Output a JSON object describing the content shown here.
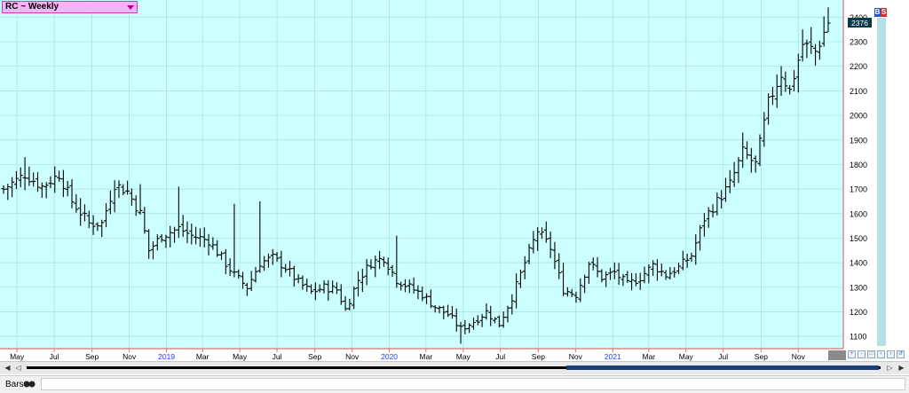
{
  "title": "RC ~ Weekly",
  "badges": {
    "b": "B",
    "s": "S"
  },
  "last_price_label": "2376",
  "status_bar": {
    "chart_style_label": "Bars"
  },
  "colors": {
    "plot_background": "#ccffff",
    "grid": "#a8dde0",
    "price_bar": "#000000",
    "axis_line": "#e07070",
    "title_box": "#f6b4f6",
    "last_price_box": "#0a3a4a",
    "year_label": "#1a3cff"
  },
  "chart_data": {
    "type": "ohlc",
    "title": "RC ~ Weekly",
    "interval": "weekly",
    "x_start": "2018-04-09",
    "x_end": "2021-12-20",
    "ylim": [
      1050,
      2470
    ],
    "y_ticks": [
      1100,
      1200,
      1300,
      1400,
      1500,
      1600,
      1700,
      1800,
      1900,
      2000,
      2100,
      2200,
      2300,
      2400
    ],
    "x_tick_labels": [
      {
        "label": "May",
        "date": "2018-05-01",
        "year": false
      },
      {
        "label": "Jul",
        "date": "2018-07-01",
        "year": false
      },
      {
        "label": "Sep",
        "date": "2018-09-01",
        "year": false
      },
      {
        "label": "Nov",
        "date": "2018-11-01",
        "year": false
      },
      {
        "label": "2019",
        "date": "2019-01-01",
        "year": true
      },
      {
        "label": "Mar",
        "date": "2019-03-01",
        "year": false
      },
      {
        "label": "May",
        "date": "2019-05-01",
        "year": false
      },
      {
        "label": "Jul",
        "date": "2019-07-01",
        "year": false
      },
      {
        "label": "Sep",
        "date": "2019-09-01",
        "year": false
      },
      {
        "label": "Nov",
        "date": "2019-11-01",
        "year": false
      },
      {
        "label": "2020",
        "date": "2020-01-01",
        "year": true
      },
      {
        "label": "Mar",
        "date": "2020-03-01",
        "year": false
      },
      {
        "label": "May",
        "date": "2020-05-01",
        "year": false
      },
      {
        "label": "Jul",
        "date": "2020-07-01",
        "year": false
      },
      {
        "label": "Sep",
        "date": "2020-09-01",
        "year": false
      },
      {
        "label": "Nov",
        "date": "2020-11-01",
        "year": false
      },
      {
        "label": "2021",
        "date": "2021-01-01",
        "year": true
      },
      {
        "label": "Mar",
        "date": "2021-03-01",
        "year": false
      },
      {
        "label": "May",
        "date": "2021-05-01",
        "year": false
      },
      {
        "label": "Jul",
        "date": "2021-07-01",
        "year": false
      },
      {
        "label": "Sep",
        "date": "2021-09-01",
        "year": false
      },
      {
        "label": "Nov",
        "date": "2021-11-01",
        "year": false
      }
    ],
    "grid": true,
    "last_value": 2376,
    "close_path": [
      [
        "2018-04-09",
        1700
      ],
      [
        "2018-05-14",
        1760
      ],
      [
        "2018-06-11",
        1710
      ],
      [
        "2018-07-09",
        1760
      ],
      [
        "2018-07-30",
        1650
      ],
      [
        "2018-08-27",
        1560
      ],
      [
        "2018-09-17",
        1560
      ],
      [
        "2018-10-08",
        1720
      ],
      [
        "2018-10-29",
        1690
      ],
      [
        "2018-11-19",
        1600
      ],
      [
        "2018-12-03",
        1450
      ],
      [
        "2018-12-24",
        1510
      ],
      [
        "2019-01-21",
        1540
      ],
      [
        "2019-02-11",
        1510
      ],
      [
        "2019-03-11",
        1490
      ],
      [
        "2019-04-01",
        1420
      ],
      [
        "2019-04-22",
        1350
      ],
      [
        "2019-05-13",
        1300
      ],
      [
        "2019-06-03",
        1400
      ],
      [
        "2019-06-24",
        1420
      ],
      [
        "2019-07-15",
        1380
      ],
      [
        "2019-08-05",
        1320
      ],
      [
        "2019-08-26",
        1280
      ],
      [
        "2019-09-16",
        1300
      ],
      [
        "2019-10-07",
        1290
      ],
      [
        "2019-10-21",
        1210
      ],
      [
        "2019-11-11",
        1330
      ],
      [
        "2019-12-02",
        1400
      ],
      [
        "2019-12-23",
        1420
      ],
      [
        "2020-01-13",
        1330
      ],
      [
        "2020-02-03",
        1300
      ],
      [
        "2020-02-24",
        1270
      ],
      [
        "2020-03-16",
        1220
      ],
      [
        "2020-04-06",
        1190
      ],
      [
        "2020-04-27",
        1130
      ],
      [
        "2020-05-18",
        1160
      ],
      [
        "2020-06-08",
        1200
      ],
      [
        "2020-06-29",
        1150
      ],
      [
        "2020-07-20",
        1260
      ],
      [
        "2020-08-10",
        1400
      ],
      [
        "2020-08-31",
        1530
      ],
      [
        "2020-09-21",
        1460
      ],
      [
        "2020-10-12",
        1290
      ],
      [
        "2020-11-02",
        1270
      ],
      [
        "2020-11-23",
        1400
      ],
      [
        "2020-12-14",
        1340
      ],
      [
        "2021-01-04",
        1360
      ],
      [
        "2021-01-25",
        1310
      ],
      [
        "2021-02-15",
        1340
      ],
      [
        "2021-03-08",
        1390
      ],
      [
        "2021-03-29",
        1350
      ],
      [
        "2021-04-19",
        1380
      ],
      [
        "2021-05-10",
        1430
      ],
      [
        "2021-05-31",
        1580
      ],
      [
        "2021-06-21",
        1650
      ],
      [
        "2021-07-12",
        1720
      ],
      [
        "2021-08-02",
        1850
      ],
      [
        "2021-08-23",
        1800
      ],
      [
        "2021-09-13",
        2050
      ],
      [
        "2021-10-04",
        2170
      ],
      [
        "2021-10-18",
        2100
      ],
      [
        "2021-11-08",
        2290
      ],
      [
        "2021-11-29",
        2260
      ],
      [
        "2021-12-20",
        2376
      ]
    ],
    "spikes": [
      {
        "date": "2018-05-14",
        "high": 1830
      },
      {
        "date": "2018-11-19",
        "high": 1720
      },
      {
        "date": "2019-01-21",
        "high": 1710
      },
      {
        "date": "2019-04-22",
        "high": 1640
      },
      {
        "date": "2019-06-03",
        "high": 1650
      },
      {
        "date": "2020-01-13",
        "high": 1510
      },
      {
        "date": "2020-04-27",
        "low": 1070
      },
      {
        "date": "2021-08-02",
        "high": 1930
      },
      {
        "date": "2021-12-20",
        "high": 2440
      }
    ]
  }
}
